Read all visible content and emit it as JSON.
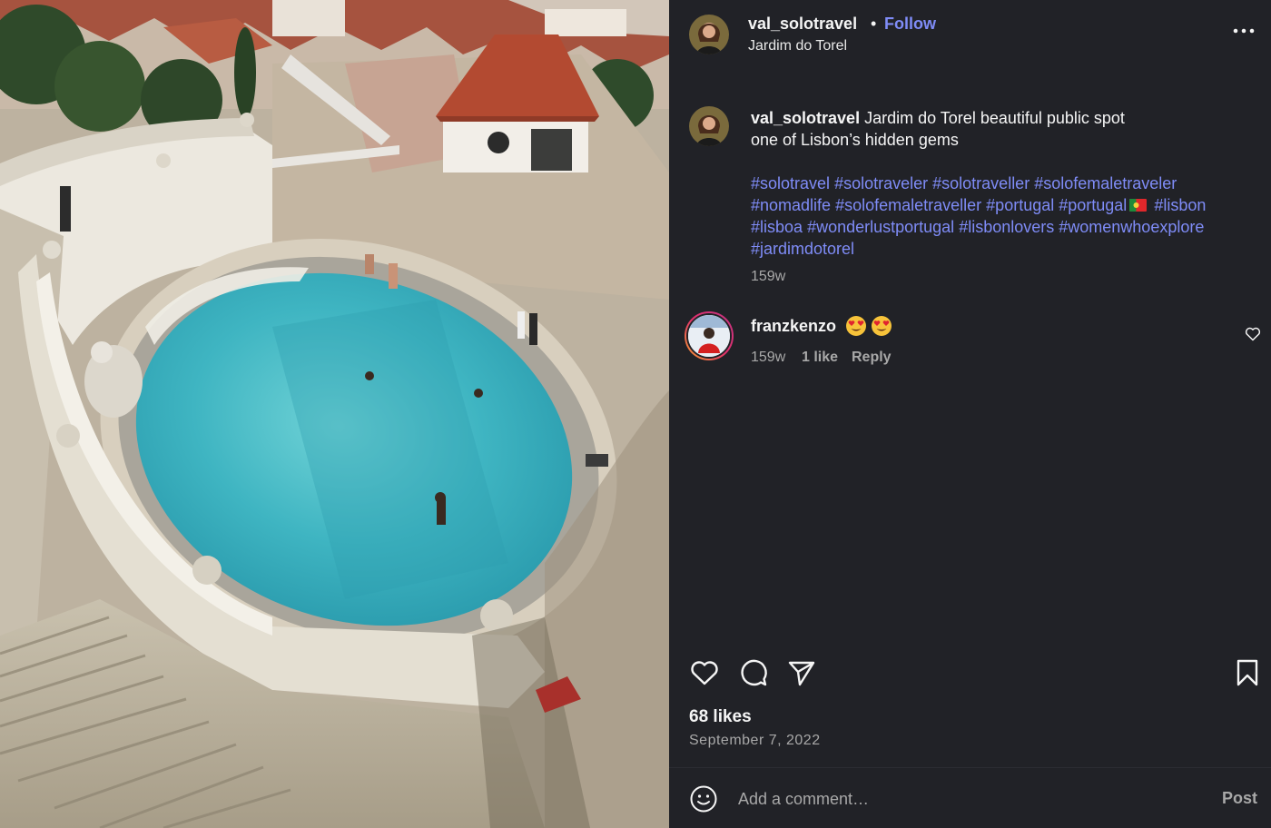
{
  "post": {
    "username": "val_solotravel",
    "separator": "•",
    "follow_label": "Follow",
    "location": "Jardim do Torel",
    "more_icon": "more-horizontal-icon"
  },
  "caption": {
    "username": "val_solotravel",
    "text_line1": "Jardim do Torel beautiful public spot",
    "text_line2": "one of Lisbon’s hidden gems",
    "hashtags": [
      "#solotravel",
      "#solotraveler",
      "#solotraveller",
      "#solofemaletraveler",
      "#nomadlife",
      "#solofemaletraveller",
      "#portugal",
      "#portugal",
      "#lisbon",
      "#lisboa",
      "#wonderlustportugal",
      "#lisbonlovers",
      "#womenwhoexplore",
      "#jardimdotorel"
    ],
    "time": "159w"
  },
  "comments": [
    {
      "username": "franzkenzo",
      "emojis": [
        "heart-eyes-emoji",
        "heart-eyes-emoji"
      ],
      "time": "159w",
      "likes_label": "1 like",
      "reply_label": "Reply"
    }
  ],
  "actions": {
    "like_icon": "heart-icon",
    "comment_icon": "comment-icon",
    "share_icon": "paper-plane-icon",
    "save_icon": "bookmark-icon"
  },
  "stats": {
    "likes": "68 likes",
    "date": "September 7, 2022"
  },
  "composer": {
    "emoji_icon": "smiley-icon",
    "placeholder": "Add a comment…",
    "post_label": "Post"
  },
  "colors": {
    "panel_bg": "#212227",
    "link_blue": "#7f8cf7",
    "muted_text": "#a8a8a8",
    "pool_water": "#4cbcc6"
  }
}
